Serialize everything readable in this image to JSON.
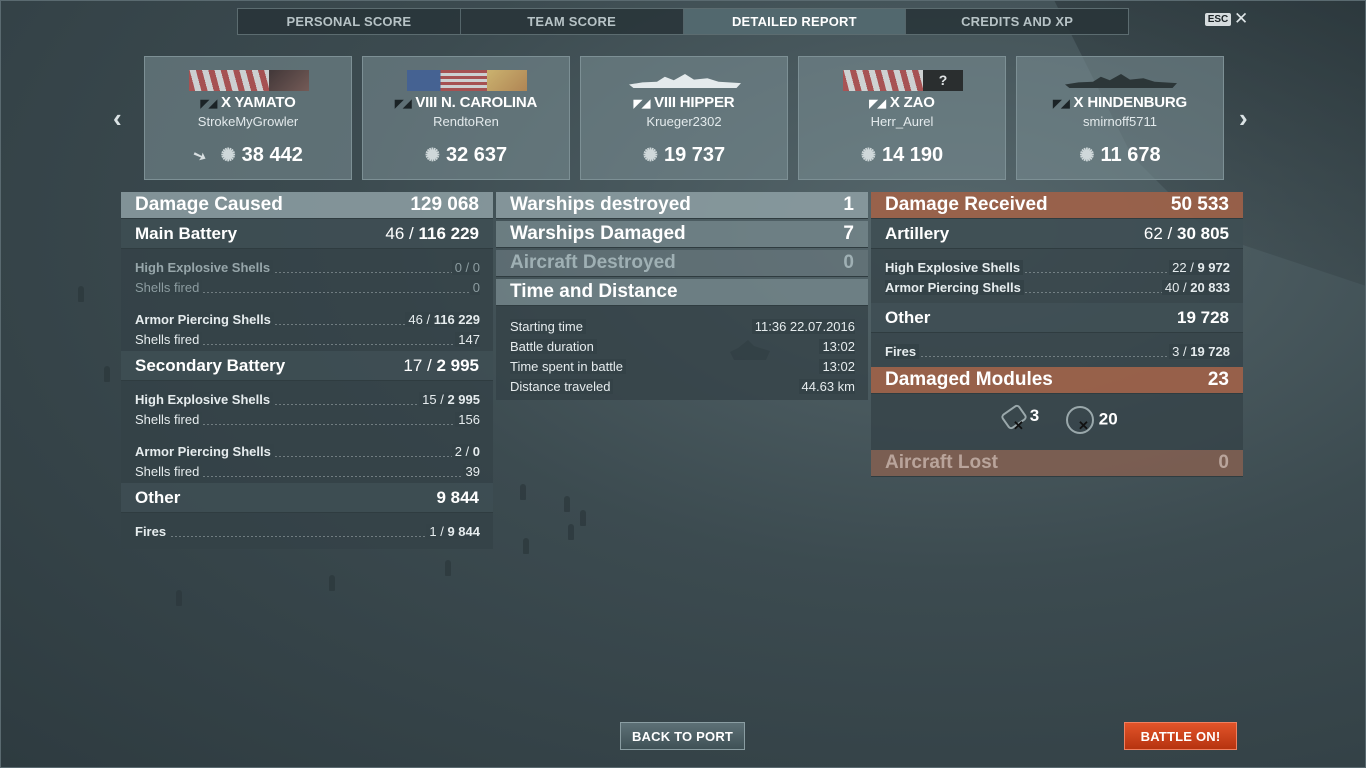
{
  "tabs": [
    {
      "label": "PERSONAL SCORE"
    },
    {
      "label": "TEAM SCORE"
    },
    {
      "label": "DETAILED REPORT"
    },
    {
      "label": "CREDITS AND XP"
    }
  ],
  "esc_label": "ESC",
  "close_glyph": "✕",
  "nav": {
    "prev_glyph": "‹",
    "next_glyph": "›"
  },
  "cards": [
    {
      "tier": "X",
      "ship": "YAMATO",
      "player": "StrokeMyGrowler",
      "score": "38 442"
    },
    {
      "tier": "VIII",
      "ship": "N. CAROLINA",
      "player": "RendtoRen",
      "score": "32 637"
    },
    {
      "tier": "VIII",
      "ship": "HIPPER",
      "player": "Krueger2302",
      "score": "19 737"
    },
    {
      "tier": "X",
      "ship": "ZAO",
      "player": "Herr_Aurel",
      "score": "14 190"
    },
    {
      "tier": "X",
      "ship": "HINDENBURG",
      "player": "smirnoff5711",
      "score": "11 678"
    }
  ],
  "damage_caused": {
    "title": "Damage Caused",
    "value": "129 068",
    "main_battery": {
      "title": "Main Battery",
      "hits": "46",
      "sep": "/",
      "damage": "116 229",
      "he_label": "High Explosive Shells",
      "he_hits": "0",
      "he_damage": "0",
      "he_fired_label": "Shells fired",
      "he_fired": "0",
      "ap_label": "Armor Piercing Shells",
      "ap_hits": "46",
      "ap_damage": "116 229",
      "ap_fired_label": "Shells fired",
      "ap_fired": "147"
    },
    "secondary_battery": {
      "title": "Secondary Battery",
      "hits": "17",
      "damage": "2 995",
      "he_label": "High Explosive Shells",
      "he_hits": "15",
      "he_damage": "2 995",
      "he_fired_label": "Shells fired",
      "he_fired": "156",
      "ap_label": "Armor Piercing Shells",
      "ap_hits": "2",
      "ap_damage": "0",
      "ap_fired_label": "Shells fired",
      "ap_fired": "39"
    },
    "other": {
      "title": "Other",
      "value": "9 844",
      "fires_label": "Fires",
      "fires_hits": "1",
      "fires_damage": "9 844"
    }
  },
  "middle": {
    "warships_destroyed_label": "Warships destroyed",
    "warships_destroyed": "1",
    "warships_damaged_label": "Warships Damaged",
    "warships_damaged": "7",
    "aircraft_destroyed_label": "Aircraft Destroyed",
    "aircraft_destroyed": "0",
    "time_distance_title": "Time and Distance",
    "starting_time_label": "Starting time",
    "starting_time": "11:36  22.07.2016",
    "battle_duration_label": "Battle duration",
    "battle_duration": "13:02",
    "time_spent_label": "Time spent in battle",
    "time_spent": "13:02",
    "distance_label": "Distance traveled",
    "distance": "44.63 km"
  },
  "damage_received": {
    "title": "Damage Received",
    "value": "50 533",
    "artillery": {
      "title": "Artillery",
      "hits": "62",
      "damage": "30 805",
      "he_label": "High Explosive Shells",
      "he_hits": "22",
      "he_damage": "9 972",
      "ap_label": "Armor Piercing Shells",
      "ap_hits": "40",
      "ap_damage": "20 833"
    },
    "other": {
      "title": "Other",
      "value": "19 728",
      "fires_label": "Fires",
      "fires_hits": "3",
      "fires_damage": "19 728"
    },
    "damaged_modules": {
      "title": "Damaged Modules",
      "value": "23",
      "turret_count": "3",
      "engine_count": "20"
    },
    "aircraft_lost_label": "Aircraft Lost",
    "aircraft_lost": "0"
  },
  "buttons": {
    "back_to_port": "BACK TO PORT",
    "battle_on": "BATTLE ON!"
  }
}
